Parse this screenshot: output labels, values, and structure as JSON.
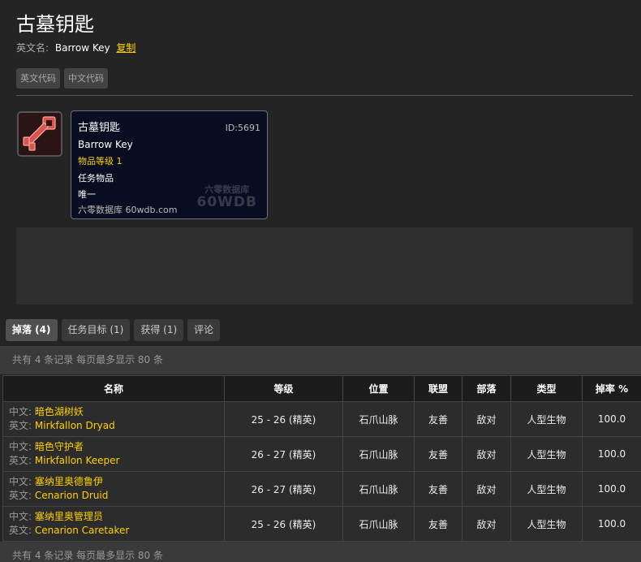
{
  "item": {
    "title": "古墓钥匙",
    "en_label": "英文名:",
    "en_name": "Barrow Key",
    "copy_label": "复制",
    "code_buttons": [
      "英文代码",
      "中文代码"
    ]
  },
  "tooltip": {
    "name": "古墓钥匙",
    "id": "ID:5691",
    "en_name": "Barrow Key",
    "item_level": "物品等级 1",
    "quest_item": "任务物品",
    "unique": "唯一",
    "site": "六零数据库 60wdb.com",
    "watermark_cn": "六零数据库",
    "watermark_en": "60WDB"
  },
  "tabs": [
    "掉落 (4)",
    "任务目标 (1)",
    "获得 (1)",
    "评论"
  ],
  "records_text": "共有 4 条记录 每页最多显示 80 条",
  "table": {
    "headers": [
      "名称",
      "等级",
      "位置",
      "联盟",
      "部落",
      "类型",
      "掉率 %"
    ],
    "cn_label": "中文:",
    "en_label": "英文:",
    "rows": [
      {
        "cn": "暗色湖树妖",
        "en": "Mirkfallon Dryad",
        "level": "25 - 26 (精英)",
        "location": "石爪山脉",
        "alliance": "友善",
        "horde": "敌对",
        "type": "人型生物",
        "rate": "100.0"
      },
      {
        "cn": "暗色守护者",
        "en": "Mirkfallon Keeper",
        "level": "26 - 27 (精英)",
        "location": "石爪山脉",
        "alliance": "友善",
        "horde": "敌对",
        "type": "人型生物",
        "rate": "100.0"
      },
      {
        "cn": "塞纳里奥德鲁伊",
        "en": "Cenarion Druid",
        "level": "26 - 27 (精英)",
        "location": "石爪山脉",
        "alliance": "友善",
        "horde": "敌对",
        "type": "人型生物",
        "rate": "100.0"
      },
      {
        "cn": "塞纳里奥管理员",
        "en": "Cenarion Caretaker",
        "level": "25 - 26 (精英)",
        "location": "石爪山脉",
        "alliance": "友善",
        "horde": "敌对",
        "type": "人型生物",
        "rate": "100.0"
      }
    ]
  },
  "colors": {
    "accent_gold": "#ffd100",
    "friendly": "#1eff00",
    "hostile": "#ff2020",
    "tooltip_bg": "#080d21"
  },
  "icons": {
    "item_icon": "red-key-icon"
  }
}
